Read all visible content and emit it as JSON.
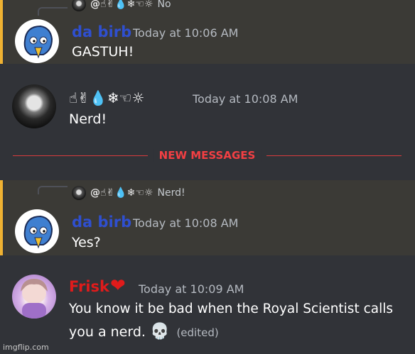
{
  "messages": [
    {
      "reply": {
        "name": "@☝✌💧❄☜☼",
        "text": "No"
      },
      "author": "da birb",
      "author_color": "#2f4fcf",
      "timestamp": "Today at 10:06 AM",
      "content": "GASTUH!",
      "avatar_icon": "blue-bird-avatar"
    },
    {
      "author": "☝✌💧❄☜☼",
      "author_color": "#ffffff",
      "timestamp": "Today at 10:08 AM",
      "content": "Nerd!",
      "avatar_icon": "gaster-avatar"
    },
    {
      "reply": {
        "name": "@☝✌💧❄☜☼",
        "text": "Nerd!"
      },
      "author": "da birb",
      "author_color": "#2f4fcf",
      "timestamp": "Today at 10:08 AM",
      "content": "Yes?",
      "avatar_icon": "blue-bird-avatar"
    },
    {
      "author": "Frisk",
      "author_color": "#e01b1b",
      "badge": "❤",
      "timestamp": "Today at 10:09 AM",
      "content_line1": "You know it be bad when the Royal Scientist calls",
      "content_line2": "you a nerd.",
      "emoji": "💀",
      "edited": "(edited)",
      "avatar_icon": "frisk-avatar"
    }
  ],
  "divider": {
    "label": "NEW MESSAGES"
  },
  "watermark": "imgflip.com"
}
